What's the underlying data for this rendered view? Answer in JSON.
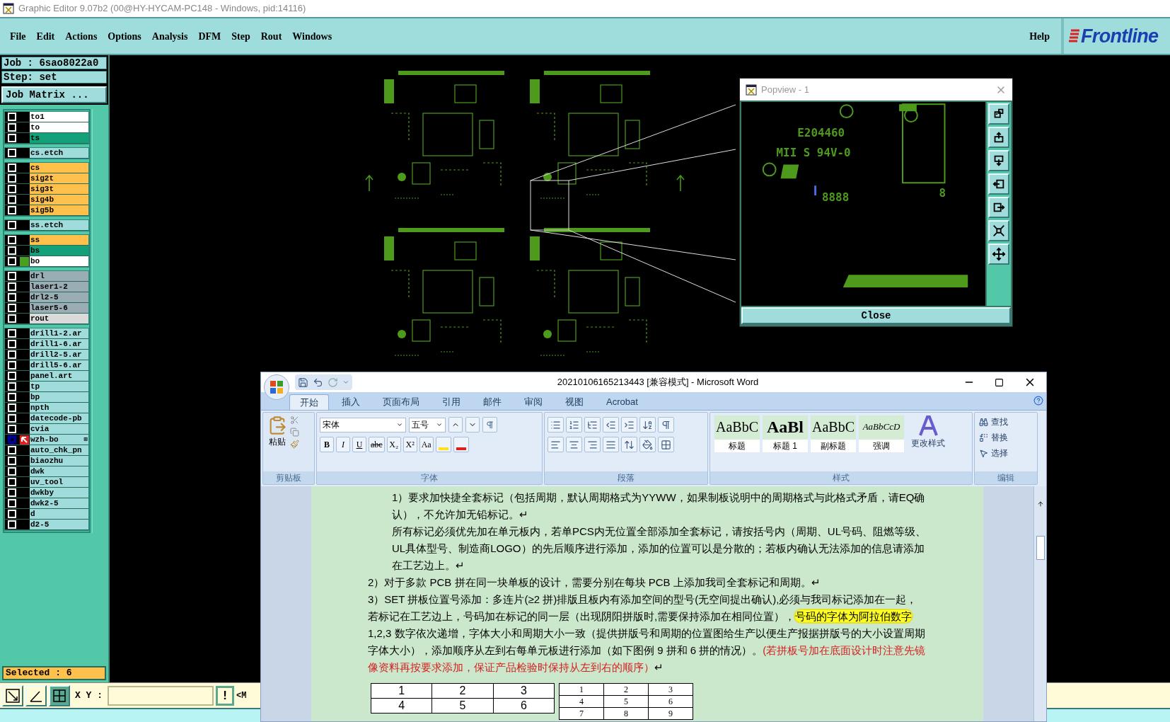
{
  "window": {
    "title": "Graphic Editor 9.07b2 (00@HY-HYCAM-PC148 - Windows, pid:14116)"
  },
  "menu": [
    {
      "label": "File"
    },
    {
      "label": "Edit"
    },
    {
      "label": "Actions"
    },
    {
      "label": "Options"
    },
    {
      "label": "Analysis"
    },
    {
      "label": "DFM"
    },
    {
      "label": "Step"
    },
    {
      "label": "Rout"
    },
    {
      "label": "Windows"
    }
  ],
  "help": "Help",
  "logo": "Frontline",
  "job_panel": {
    "job": "Job : 6sao8022a0",
    "step": "Step: set",
    "matrix_button": "Job Matrix ..."
  },
  "layer_groups": [
    {
      "layers": [
        {
          "name": "to1",
          "color": "#ffffff",
          "affected": false,
          "work_layer": false
        },
        {
          "name": "to",
          "color": "#ffffff",
          "affected": false,
          "work_layer": false
        },
        {
          "name": "ts",
          "color": "#14a078",
          "affected": false,
          "work_layer": false
        }
      ]
    },
    {
      "layers": [
        {
          "name": "cs.etch",
          "color": "#a0dcdc",
          "affected": false,
          "work_layer": false
        }
      ]
    },
    {
      "layers": [
        {
          "name": "cs",
          "color": "#ffc04c",
          "affected": false,
          "work_layer": false
        },
        {
          "name": "sig2t",
          "color": "#ffc04c",
          "affected": false,
          "work_layer": false
        },
        {
          "name": "sig3t",
          "color": "#ffc04c",
          "affected": false,
          "work_layer": false
        },
        {
          "name": "sig4b",
          "color": "#ffc04c",
          "affected": false,
          "work_layer": false
        },
        {
          "name": "sig5b",
          "color": "#ffc04c",
          "affected": false,
          "work_layer": false
        }
      ]
    },
    {
      "layers": [
        {
          "name": "ss.etch",
          "color": "#a0dcdc",
          "affected": false,
          "work_layer": false
        }
      ]
    },
    {
      "layers": [
        {
          "name": "ss",
          "color": "#ffc04c",
          "affected": false,
          "work_layer": false
        },
        {
          "name": "bs",
          "color": "#14a078",
          "affected": false,
          "work_layer": false
        },
        {
          "name": "bo",
          "color": "#ffffff",
          "affected": true,
          "work_layer": false
        }
      ]
    },
    {
      "layers": [
        {
          "name": "drl",
          "color": "#9aacb4",
          "affected": false,
          "work_layer": false
        },
        {
          "name": "laser1-2",
          "color": "#9aacb4",
          "affected": false,
          "work_layer": false
        },
        {
          "name": "drl2-5",
          "color": "#9aacb4",
          "affected": false,
          "work_layer": false
        },
        {
          "name": "laser5-6",
          "color": "#9aacb4",
          "affected": false,
          "work_layer": false
        },
        {
          "name": "rout",
          "color": "#dadada",
          "affected": false,
          "work_layer": false
        }
      ]
    },
    {
      "layers": [
        {
          "name": "drill1-2.ar",
          "color": "#a0dcdc",
          "affected": false,
          "work_layer": false
        },
        {
          "name": "drill1-6.ar",
          "color": "#a0dcdc",
          "affected": false,
          "work_layer": false
        },
        {
          "name": "drill2-5.ar",
          "color": "#a0dcdc",
          "affected": false,
          "work_layer": false
        },
        {
          "name": "drill5-6.ar",
          "color": "#a0dcdc",
          "affected": false,
          "work_layer": false
        },
        {
          "name": "panel.art",
          "color": "#a0dcdc",
          "affected": false,
          "work_layer": false
        },
        {
          "name": "tp",
          "color": "#a0dcdc",
          "affected": false,
          "work_layer": false
        },
        {
          "name": "bp",
          "color": "#a0dcdc",
          "affected": false,
          "work_layer": false
        },
        {
          "name": "npth",
          "color": "#a0dcdc",
          "affected": false,
          "work_layer": false
        },
        {
          "name": "datecode-pb",
          "color": "#a0dcdc",
          "affected": false,
          "work_layer": false
        },
        {
          "name": "cvia",
          "color": "#a0dcdc",
          "affected": false,
          "work_layer": false
        },
        {
          "name": "wzh-bo",
          "color": "#a0dcdc",
          "affected": false,
          "work_layer": true,
          "suffix": "⊞"
        },
        {
          "name": "auto_chk_pn",
          "color": "#a0dcdc",
          "affected": false,
          "work_layer": false
        },
        {
          "name": "biaozhu",
          "color": "#a0dcdc",
          "affected": false,
          "work_layer": false
        },
        {
          "name": "dwk",
          "color": "#a0dcdc",
          "affected": false,
          "work_layer": false
        },
        {
          "name": "uv_tool",
          "color": "#a0dcdc",
          "affected": false,
          "work_layer": false
        },
        {
          "name": "dwkby",
          "color": "#a0dcdc",
          "affected": false,
          "work_layer": false
        },
        {
          "name": "dwk2-5",
          "color": "#a0dcdc",
          "affected": false,
          "work_layer": false
        },
        {
          "name": "d",
          "color": "#a0dcdc",
          "affected": false,
          "work_layer": false
        },
        {
          "name": "d2-5",
          "color": "#a0dcdc",
          "affected": false,
          "work_layer": false
        }
      ]
    }
  ],
  "selected_count": "Selected : 6",
  "toolbar": {
    "xy_label": "X Y :",
    "alert_button": "!",
    "overflow_text": "<M"
  },
  "popview": {
    "title": "Popview - 1",
    "close": "Close",
    "view_texts": [
      "E204460",
      "MII S 94V-0",
      "8888",
      "8"
    ]
  },
  "word": {
    "title": "20210106165213443 [兼容模式] - Microsoft Word",
    "tabs": [
      {
        "label": "开始",
        "selected": true
      },
      {
        "label": "插入",
        "selected": false
      },
      {
        "label": "页面布局",
        "selected": false
      },
      {
        "label": "引用",
        "selected": false
      },
      {
        "label": "邮件",
        "selected": false
      },
      {
        "label": "审阅",
        "selected": false
      },
      {
        "label": "视图",
        "selected": false
      },
      {
        "label": "Acrobat",
        "selected": false
      }
    ],
    "paste": "粘贴",
    "font_name": "宋体",
    "font_size": "五号",
    "format_buttons": [
      "B",
      "I",
      "U",
      "abc",
      "X₂",
      "X²",
      "Aa"
    ],
    "styles": [
      {
        "sample": "AaBbC",
        "label": "标题",
        "kind": "serif"
      },
      {
        "sample": "AaBl",
        "label": "标题 1",
        "kind": "large"
      },
      {
        "sample": "AaBbC",
        "label": "副标题",
        "kind": "serif"
      },
      {
        "sample": "AaBbCcD",
        "label": "强调",
        "kind": "italic"
      }
    ],
    "change_styles": "更改样式",
    "edit_actions": [
      "查找",
      "替换",
      "选择"
    ],
    "groups": [
      "剪贴板",
      "字体",
      "段落",
      "样式",
      "编辑"
    ],
    "paragraphs": [
      {
        "kind": "sub",
        "segments": [
          {
            "text": "1）要求加快捷全套标记（包括周期，默认周期格式为YYWW，如果制板说明中的周期格式与此格式矛盾，请EQ确认），不允许加无铅标记。↵",
            "highlight": false,
            "red": false
          }
        ]
      },
      {
        "kind": "sub",
        "segments": [
          {
            "text": "所有标记必须优先加在单元板内，若单PCS内无位置全部添加全套标记，请按括号内（周期、UL号码、阻燃等级、UL具体型号、制造商LOGO）的先后顺序进行添加，添加的位置可以是分散的；若板内确认无法添加的信息请添加在工艺边上。↵",
            "highlight": false,
            "red": false
          }
        ]
      },
      {
        "kind": "item",
        "segments": [
          {
            "text": "2）对于多款 PCB 拼在同一块单板的设计，需要分别在每块 PCB 上添加我司全套标记和周期。↵",
            "highlight": false,
            "red": false
          }
        ]
      },
      {
        "kind": "item",
        "segments": [
          {
            "text": "3）SET 拼板位置号添加：多连片(≥2 拼)排版且板内有添加空间的型号(无空间提出确认),必须与我司标记添加在一起，若标记在工艺边上，号码加在标记的同一层（出现阴阳拼版时,需要保持添加在相同位置），",
            "highlight": false,
            "red": false
          },
          {
            "text": "号码的字体为阿拉伯数字",
            "highlight": true,
            "red": false
          },
          {
            "text": " 1,2,3 数字依次递增，字体大小和周期大小一致（提供拼版号和周期的位置图给生产以便生产报据拼版号的大小设置周期字体大小），添加顺序从左到右每单元板进行添加（如下图例 9 拼和 6 拼的情况）。",
            "highlight": false,
            "red": false
          },
          {
            "text": "(若拼板号加在底面设计时注意先镜像资料再按要求添加，保证产品检验时保持从左到右的顺序）",
            "highlight": false,
            "red": true
          },
          {
            "text": "↵",
            "highlight": false,
            "red": false
          }
        ]
      }
    ],
    "tables": [
      {
        "kind": "large",
        "rows": [
          [
            "1",
            "2",
            "3"
          ],
          [
            "4",
            "5",
            "6"
          ]
        ]
      },
      {
        "kind": "small",
        "rows": [
          [
            "1",
            "2",
            "3"
          ],
          [
            "4",
            "5",
            "6"
          ],
          [
            "7",
            "8",
            "9"
          ]
        ]
      }
    ]
  }
}
